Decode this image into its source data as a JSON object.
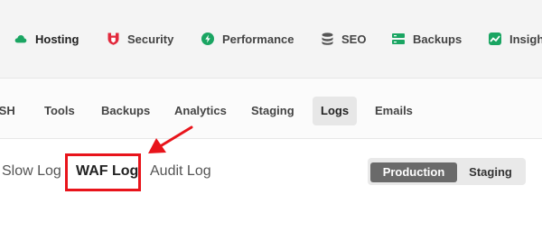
{
  "top_nav": {
    "items": [
      {
        "label": "Hosting",
        "icon": "cloud-icon",
        "color": "#1aa562"
      },
      {
        "label": "Security",
        "icon": "shield-icon",
        "color": "#e2293c"
      },
      {
        "label": "Performance",
        "icon": "lightning-icon",
        "color": "#1aa562"
      },
      {
        "label": "SEO",
        "icon": "database-icon",
        "color": "#555555"
      },
      {
        "label": "Backups",
        "icon": "backup-icon",
        "color": "#1aa562"
      },
      {
        "label": "Insigh",
        "icon": "chart-icon",
        "color": "#1aa562"
      }
    ],
    "active": "Hosting"
  },
  "sub_nav": {
    "items": [
      "SSH",
      "Tools",
      "Backups",
      "Analytics",
      "Staging",
      "Logs",
      "Emails"
    ],
    "active": "Logs"
  },
  "log_tabs": {
    "items": [
      "Slow Log",
      "WAF Log",
      "Audit Log"
    ],
    "active": "WAF Log"
  },
  "environment_toggle": {
    "options": [
      "Production",
      "Staging"
    ],
    "selected": "Production"
  },
  "annotation": {
    "color": "#e8141b"
  }
}
